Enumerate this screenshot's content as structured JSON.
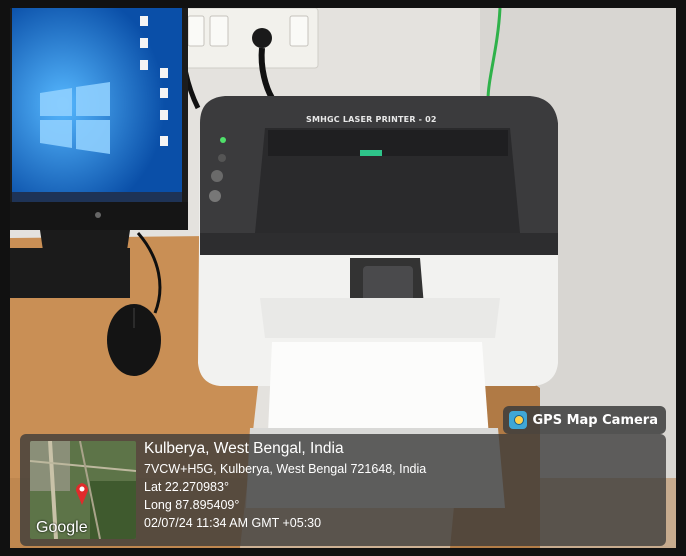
{
  "printer": {
    "model_label": "SMHGC LASER PRINTER - 02"
  },
  "overlay": {
    "app_badge": "GPS Map Camera",
    "map_attribution": "Google",
    "place_title": "Kulberya, West Bengal, India",
    "address": "7VCW+H5G, Kulberya, West Bengal 721648, India",
    "latitude": "Lat 22.270983°",
    "longitude": "Long 87.895409°",
    "timestamp": "02/07/24 11:34 AM GMT +05:30"
  },
  "colors": {
    "badge_bg": "#3a3a3a",
    "panel_bg": "#3a3a3a",
    "monitor_screen": "#0b5cbf"
  }
}
